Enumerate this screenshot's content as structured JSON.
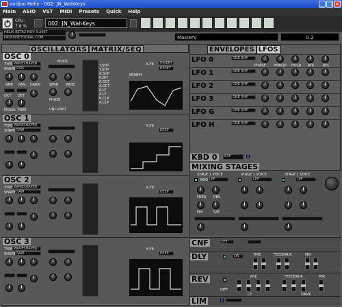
{
  "window": {
    "title": "audjoo Helix - 002: JN_WahKeys"
  },
  "menu": [
    "Main",
    "ASIO",
    "VST",
    "MIDI",
    "Presets",
    "Quick",
    "Help"
  ],
  "toolbar": {
    "cpu_label": "CPU:",
    "cpu_value": "7.8 %",
    "patch": "002: JN_WahKeys",
    "info1": "HELIX BETA2 NOV 3 2007",
    "info2": "INORISSETOOKAL.COM"
  },
  "master": {
    "label": "MasterV",
    "value": "0.2"
  },
  "left_tabs": [
    "OSCILLATORS",
    "MATRIX/SEQ"
  ],
  "oscillators": [
    {
      "name": "OSC 0",
      "type": "WAVESHAPER",
      "shape": "OSN"
    },
    {
      "name": "OSC 1",
      "type": "WAVESHAPER",
      "shape": "SAW"
    },
    {
      "name": "OSC 2",
      "type": "WAVESHAPER",
      "shape": "SAW"
    },
    {
      "name": "OSC 3",
      "type": "WAVESHAPER",
      "shape": "SAW"
    }
  ],
  "osc_labels": {
    "type": "TYPE",
    "shape": "SHAPE",
    "amp": "AMP",
    "pan": "PAN",
    "harm": "HARM",
    "oct": "OCT",
    "det": "DET",
    "phase": "PHASE",
    "free": "FREE",
    "multi": "MULTI",
    "spr": "SPRD",
    "wide": "WIDE",
    "phs": "PHASE",
    "uni": "UNI",
    "unispr": "UNI-SPRD",
    "morph": "MORPH",
    "invert": "INVERT",
    "reset": "RESET",
    "keep": "KEEP",
    "waveshaper": "WAVESHAPER",
    "mods": [
      "T.SHP",
      "T.SHP",
      "A.SHP",
      "R.BIT",
      "R.OCT",
      "A.OCT",
      "R.LF",
      "A.LF",
      "R.CLP",
      "A.CLP"
    ],
    "stack": [
      "K.F6",
      "K.F6",
      "K.F6",
      "K.F6"
    ]
  },
  "right_tabs": [
    "ENVELOPES",
    "LFOS"
  ],
  "lfos": [
    {
      "name": "LFO 0",
      "shape": "ONE SHP"
    },
    {
      "name": "LFO 1",
      "shape": "ONE SHP"
    },
    {
      "name": "LFO 2",
      "shape": "ONE SHP"
    },
    {
      "name": "LFO 3",
      "shape": "ONE SHP"
    },
    {
      "name": "LFO G",
      "shape": "ONE SHP"
    },
    {
      "name": "LFO H",
      "shape": "ONE SHP"
    }
  ],
  "lfo_labels": [
    "PHASE",
    "PERIOD",
    "HOLD",
    "ATK",
    "REL"
  ],
  "kbd": {
    "name": "KBD 0",
    "value": "EXP"
  },
  "mixing": {
    "title": "MIXING STAGES",
    "filter_labels": [
      "MODE",
      "LPF",
      "FREQ",
      "RES",
      "PHI",
      "SAT"
    ],
    "stages": [
      "STAGE 1 VOICE",
      "STAGE 1 VOICE",
      "STAGE 1 VOICE"
    ]
  },
  "fx": [
    {
      "name": "CNF",
      "value": "EFT"
    },
    {
      "name": "DLY",
      "value": "ON"
    },
    {
      "name": "REV",
      "value": "DIFF"
    },
    {
      "name": "LIM",
      "value": ""
    }
  ],
  "fx_labels": {
    "time": "TIME",
    "feedback": "FEEDBACK",
    "mix": "MIX",
    "pre": "PRE",
    "lp": "LP",
    "damp": "DAMP"
  }
}
